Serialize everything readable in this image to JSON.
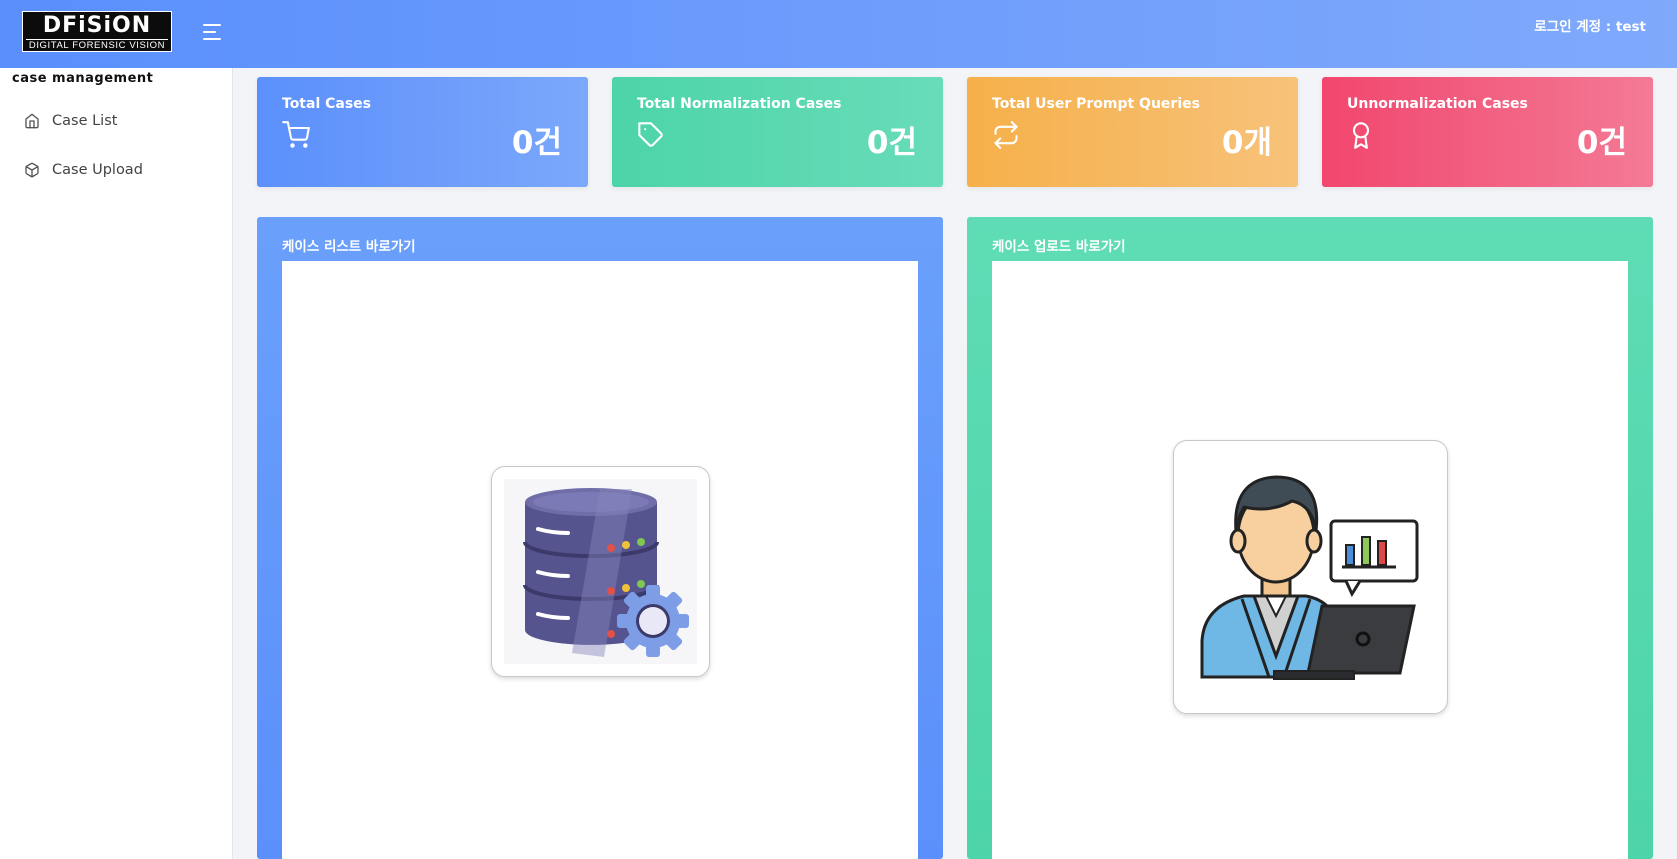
{
  "header": {
    "logo_main": "DFiSiON",
    "logo_sub": "DIGITAL FORENSIC VISION",
    "login_text": "로그인 계정 : test"
  },
  "sidebar": {
    "section_title": "case management",
    "items": [
      {
        "label": "Case List",
        "icon": "home-icon"
      },
      {
        "label": "Case Upload",
        "icon": "box-icon"
      }
    ]
  },
  "stats": [
    {
      "label": "Total Cases",
      "value": "0건",
      "icon": "cart-icon",
      "color": "#5b8ffb"
    },
    {
      "label": "Total Normalization Cases",
      "value": "0건",
      "icon": "tag-icon",
      "color": "#4dd4a8"
    },
    {
      "label": "Total User Prompt Queries",
      "value": "0개",
      "icon": "repeat-icon",
      "color": "#f6b04a"
    },
    {
      "label": "Unnormalization Cases",
      "value": "0건",
      "icon": "award-icon",
      "color": "#f2466e"
    }
  ],
  "panels": [
    {
      "title": "케이스 리스트 바로가기",
      "image": "database-gear-illustration"
    },
    {
      "title": "케이스 업로드 바로가기",
      "image": "analyst-laptop-illustration"
    }
  ]
}
